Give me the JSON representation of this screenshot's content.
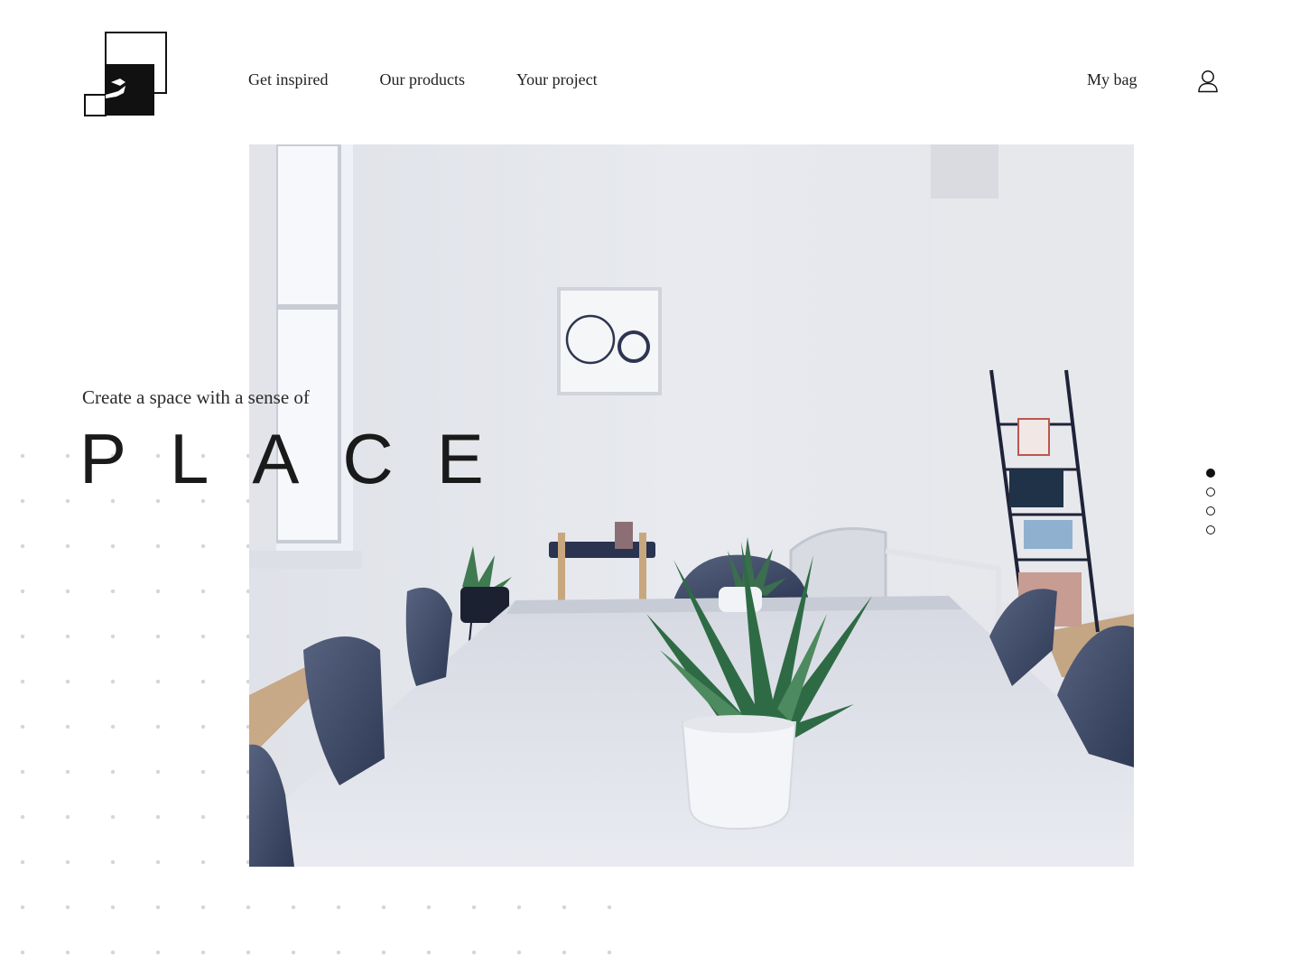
{
  "header": {
    "nav": [
      "Get inspired",
      "Our products",
      "Your project"
    ],
    "bag_label": "My bag"
  },
  "hero": {
    "tagline": "Create a space with a sense of",
    "headline": "PLACE"
  },
  "pager": {
    "count": 4,
    "active": 1
  },
  "colors": {
    "text": "#1a1a1a",
    "dots": "#d6d6d6",
    "chairs": "#3f4b6b"
  }
}
